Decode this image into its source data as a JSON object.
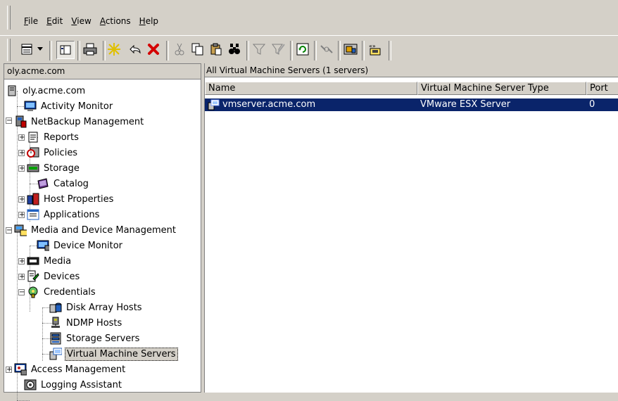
{
  "menu": {
    "items": [
      {
        "label": "File",
        "u": "F",
        "rest": "ile"
      },
      {
        "label": "Edit",
        "u": "E",
        "rest": "dit"
      },
      {
        "label": "View",
        "u": "V",
        "rest": "iew"
      },
      {
        "label": "Actions",
        "u": "A",
        "rest": "ctions"
      },
      {
        "label": "Help",
        "u": "H",
        "rest": "elp"
      }
    ]
  },
  "left_pane": {
    "header": "oly.acme.com",
    "tree": [
      {
        "label": "oly.acme.com"
      },
      {
        "label": "Activity Monitor"
      },
      {
        "label": "NetBackup Management"
      },
      {
        "label": "Reports"
      },
      {
        "label": "Policies"
      },
      {
        "label": "Storage"
      },
      {
        "label": "Catalog"
      },
      {
        "label": "Host Properties"
      },
      {
        "label": "Applications"
      },
      {
        "label": "Media and Device Management"
      },
      {
        "label": "Device Monitor"
      },
      {
        "label": "Media"
      },
      {
        "label": "Devices"
      },
      {
        "label": "Credentials"
      },
      {
        "label": "Disk Array Hosts"
      },
      {
        "label": "NDMP Hosts"
      },
      {
        "label": "Storage Servers"
      },
      {
        "label": "Virtual Machine Servers"
      },
      {
        "label": "Access Management"
      },
      {
        "label": "Logging Assistant"
      }
    ]
  },
  "right_pane": {
    "title": "All Virtual Machine Servers (1 servers)",
    "columns": [
      "Name",
      "Virtual Machine Server Type",
      "Port"
    ],
    "rows": [
      {
        "name": "vmserver.acme.com",
        "type": "VMware ESX Server",
        "port": "0"
      }
    ]
  },
  "colors": {
    "selection": "#0a246a",
    "window_face": "#d4d0c8"
  }
}
